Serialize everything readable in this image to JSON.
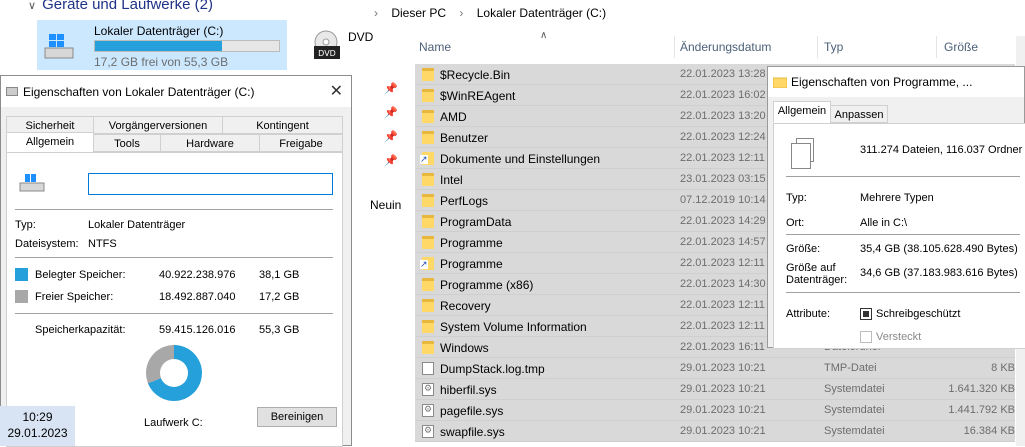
{
  "explorer": {
    "group_header": "Geräte und Laufwerke (2)",
    "drive": {
      "name": "Lokaler Datenträger (C:)",
      "free_text": "17,2 GB frei von 55,3 GB",
      "used_fraction": 0.69
    },
    "dvd_label": "DVD",
    "dvd_badge": "DVD",
    "sidebar_partial": "Neuin",
    "breadcrumb": [
      "Dieser PC",
      "Lokaler Datenträger (C:)"
    ],
    "columns": {
      "name": "Name",
      "date": "Änderungsdatum",
      "type": "Typ",
      "size": "Größe"
    },
    "rows": [
      {
        "name": "$Recycle.Bin",
        "date": "22.01.2023 13:28",
        "type": "",
        "size": "",
        "icon": "folder"
      },
      {
        "name": "$WinREAgent",
        "date": "22.01.2023 16:02",
        "type": "",
        "size": "",
        "icon": "folder"
      },
      {
        "name": "AMD",
        "date": "22.01.2023 13:20",
        "type": "",
        "size": "",
        "icon": "folder"
      },
      {
        "name": "Benutzer",
        "date": "22.01.2023 12:24",
        "type": "",
        "size": "",
        "icon": "folder"
      },
      {
        "name": "Dokumente und Einstellungen",
        "date": "22.01.2023 12:11",
        "type": "",
        "size": "",
        "icon": "link"
      },
      {
        "name": "Intel",
        "date": "23.01.2023 03:15",
        "type": "",
        "size": "",
        "icon": "folder"
      },
      {
        "name": "PerfLogs",
        "date": "07.12.2019 10:14",
        "type": "",
        "size": "",
        "icon": "folder"
      },
      {
        "name": "ProgramData",
        "date": "22.01.2023 14:29",
        "type": "",
        "size": "",
        "icon": "folder"
      },
      {
        "name": "Programme",
        "date": "22.01.2023 14:57",
        "type": "",
        "size": "",
        "icon": "folder"
      },
      {
        "name": "Programme",
        "date": "22.01.2023 12:11",
        "type": "",
        "size": "",
        "icon": "link"
      },
      {
        "name": "Programme (x86)",
        "date": "22.01.2023 14:30",
        "type": "",
        "size": "",
        "icon": "folder"
      },
      {
        "name": "Recovery",
        "date": "22.01.2023 12:11",
        "type": "",
        "size": "",
        "icon": "folder"
      },
      {
        "name": "System Volume Information",
        "date": "22.01.2023 12:11",
        "type": "",
        "size": "",
        "icon": "folder"
      },
      {
        "name": "Windows",
        "date": "22.01.2023 16:11",
        "type": "Dateiordner",
        "size": "",
        "icon": "folder"
      },
      {
        "name": "DumpStack.log.tmp",
        "date": "29.01.2023 10:21",
        "type": "TMP-Datei",
        "size": "8 KB",
        "icon": "file"
      },
      {
        "name": "hiberfil.sys",
        "date": "29.01.2023 10:21",
        "type": "Systemdatei",
        "size": "1.641.320 KB",
        "icon": "sys"
      },
      {
        "name": "pagefile.sys",
        "date": "29.01.2023 10:21",
        "type": "Systemdatei",
        "size": "1.441.792 KB",
        "icon": "sys"
      },
      {
        "name": "swapfile.sys",
        "date": "29.01.2023 10:21",
        "type": "Systemdatei",
        "size": "16.384 KB",
        "icon": "sys"
      }
    ]
  },
  "drive_dialog": {
    "title": "Eigenschaften von Lokaler Datenträger (C:)",
    "tabs_row1": [
      "Sicherheit",
      "Vorgängerversionen",
      "Kontingent"
    ],
    "tabs_row2": [
      "Allgemein",
      "Tools",
      "Hardware",
      "Freigabe"
    ],
    "name_value": "",
    "type_label": "Typ:",
    "type_value": "Lokaler Datenträger",
    "fs_label": "Dateisystem:",
    "fs_value": "NTFS",
    "used_label": "Belegter Speicher:",
    "used_bytes": "40.922.238.976",
    "used_gb": "38,1 GB",
    "free_label": "Freier Speicher:",
    "free_bytes": "18.492.887.040",
    "free_gb": "17,2 GB",
    "capacity_label": "Speicherkapazität:",
    "capacity_bytes": "59.415.126.016",
    "capacity_gb": "55,3 GB",
    "used_fraction": 0.689,
    "drive_label": "Laufwerk C:",
    "cleanup_button": "Bereinigen",
    "colors": {
      "used": "#26a0da",
      "free": "#a8a8a8"
    }
  },
  "prog_dialog": {
    "title": "Eigenschaften von Programme, ...",
    "tabs": [
      "Allgemein",
      "Anpassen"
    ],
    "summary": "311.274 Dateien, 116.037 Ordner",
    "type_label": "Typ:",
    "type_value": "Mehrere Typen",
    "location_label": "Ort:",
    "location_value": "Alle in C:\\",
    "size_label": "Größe:",
    "size_value": "35,4 GB (38.105.628.490 Bytes)",
    "disk_size_label_1": "Größe auf",
    "disk_size_label_2": "Datenträger:",
    "disk_size_value": "34,6 GB (37.183.983.616 Bytes)",
    "attributes_label": "Attribute:",
    "readonly_label": "Schreibgeschützt",
    "hidden_label": "Versteckt"
  },
  "taskbar": {
    "time": "10:29",
    "date": "29.01.2023"
  }
}
